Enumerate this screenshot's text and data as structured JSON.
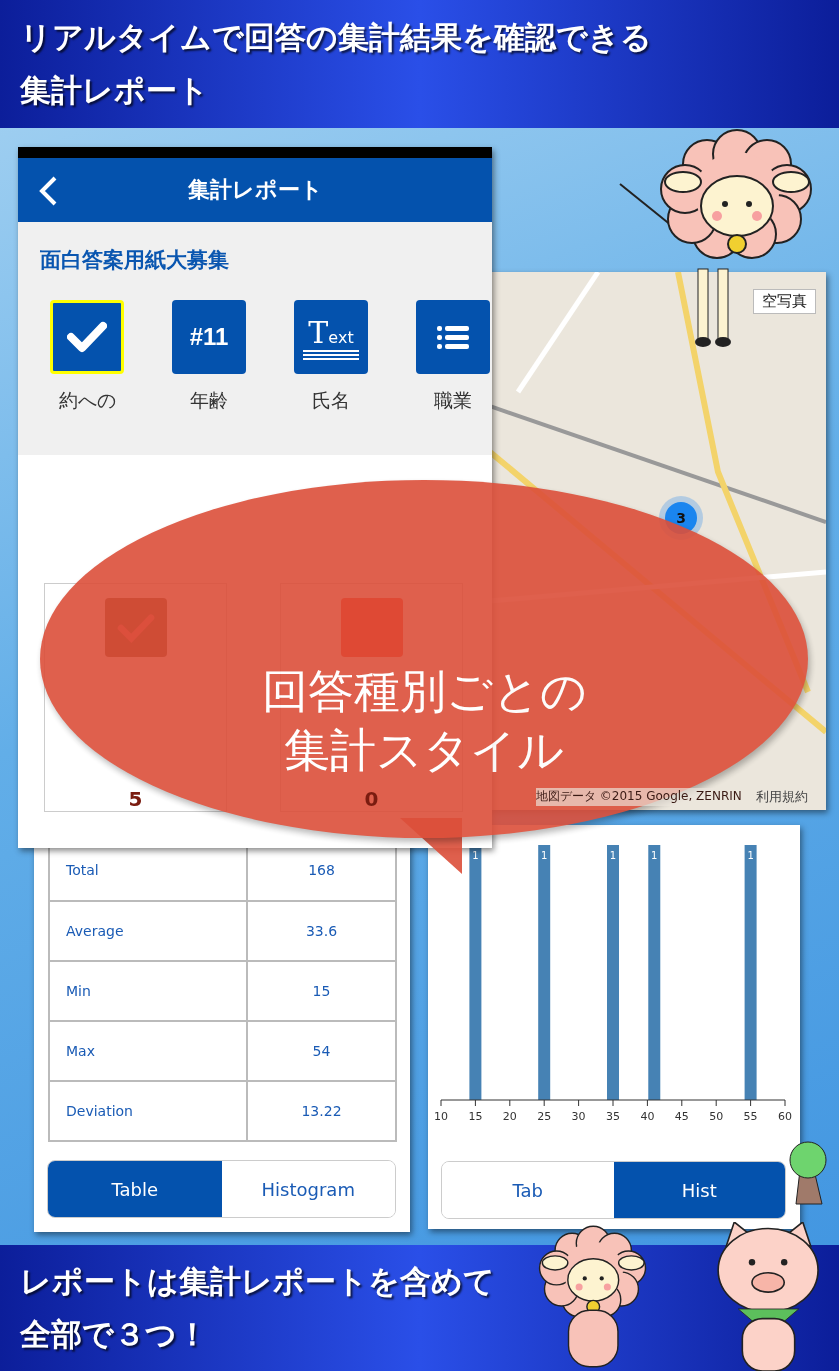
{
  "top_banner": {
    "lines": [
      "リアルタイムで回答の集計結果を確認できる",
      "集計レポート"
    ]
  },
  "phone": {
    "title": "集計レポート",
    "survey_title": "面白答案用紙大募集",
    "questions": [
      {
        "kind": "checkbox",
        "label": "約への",
        "selected": true
      },
      {
        "kind": "number",
        "icon_text": "#11",
        "label": "年齢",
        "selected": false
      },
      {
        "kind": "text",
        "icon_text": "Text",
        "label": "氏名",
        "selected": false
      },
      {
        "kind": "list",
        "label": "職業",
        "selected": false
      }
    ],
    "answer_counts": [
      {
        "kind": "checked",
        "count": "5"
      },
      {
        "kind": "unchecked",
        "count": "0"
      }
    ]
  },
  "map": {
    "aerial_button": "空写真",
    "cluster_count": "3",
    "attribution": "地図データ ©2015 Google, ZENRIN",
    "terms_link": "利用規約"
  },
  "stats": {
    "rows": [
      {
        "label": "Total",
        "value": "168"
      },
      {
        "label": "Average",
        "value": "33.6"
      },
      {
        "label": "Min",
        "value": "15"
      },
      {
        "label": "Max",
        "value": "54"
      },
      {
        "label": "Deviation",
        "value": "13.22"
      }
    ],
    "view_tabs": [
      {
        "label": "Table",
        "selected": true
      },
      {
        "label": "Histogram",
        "selected": false
      }
    ]
  },
  "histogram": {
    "chart_data": {
      "type": "bar",
      "x": [
        15,
        25,
        35,
        41,
        55
      ],
      "values": [
        1,
        1,
        1,
        1,
        1
      ],
      "xticks": [
        10,
        15,
        20,
        25,
        30,
        35,
        40,
        45,
        50,
        55,
        60
      ],
      "xlim": [
        10,
        60
      ],
      "data_labels": true
    },
    "view_tabs": [
      {
        "label": "Tab",
        "selected": false
      },
      {
        "label": "Hist",
        "selected": true
      }
    ]
  },
  "bubble": {
    "lines": [
      "回答種別ごとの",
      "集計スタイル"
    ]
  },
  "bottom_banner": {
    "lines": [
      "レポートは集計レポートを含めて",
      "全部で３つ！"
    ]
  }
}
